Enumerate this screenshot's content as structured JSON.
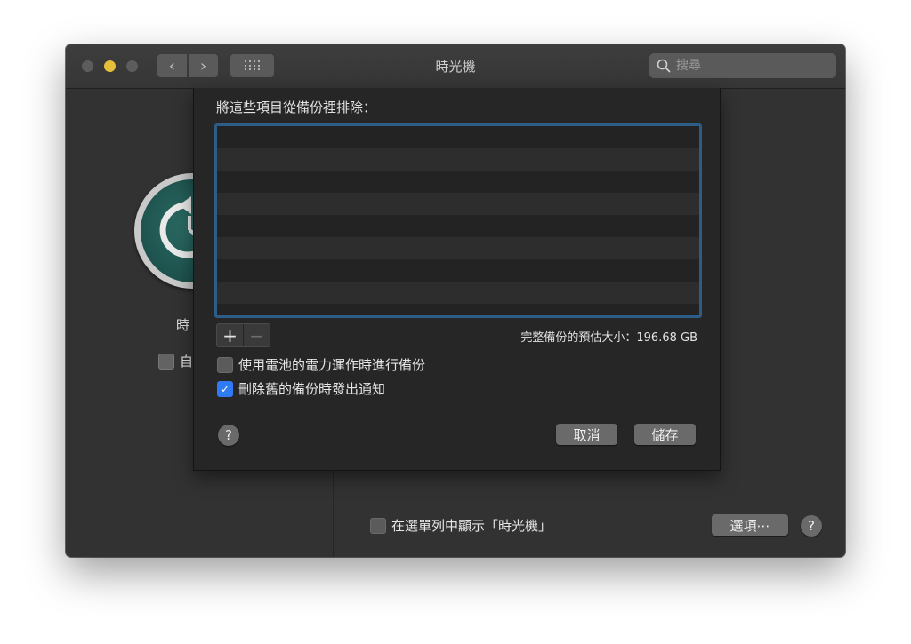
{
  "window": {
    "title": "時光機",
    "nav": {
      "back_icon": "‹",
      "forward_icon": "›"
    },
    "search": {
      "placeholder": "搜尋"
    }
  },
  "left": {
    "label": "時",
    "auto_backup_label": "自",
    "auto_backup_checked": false
  },
  "sheet": {
    "heading": "將這些項目從備份裡排除：",
    "exclude_list": {
      "items": [],
      "visible_rows": 8
    },
    "add_label": "+",
    "remove_label": "−",
    "size_estimate": "完整備份的預估大小：196.68 GB",
    "options": [
      {
        "label": "使用電池的電力運作時進行備份",
        "checked": false
      },
      {
        "label": "刪除舊的備份時發出通知",
        "checked": true
      }
    ],
    "help_label": "?",
    "cancel_label": "取消",
    "save_label": "儲存"
  },
  "footer": {
    "show_in_menubar_label": "在選單列中顯示「時光機」",
    "show_in_menubar_checked": false,
    "options_label": "選項⋯",
    "help_label": "?"
  },
  "colors": {
    "accent": "#2f7bf5",
    "list_focus_border": "#2d5c86",
    "minimize_button": "#e6bf3a",
    "icon_teal": "#174742"
  }
}
